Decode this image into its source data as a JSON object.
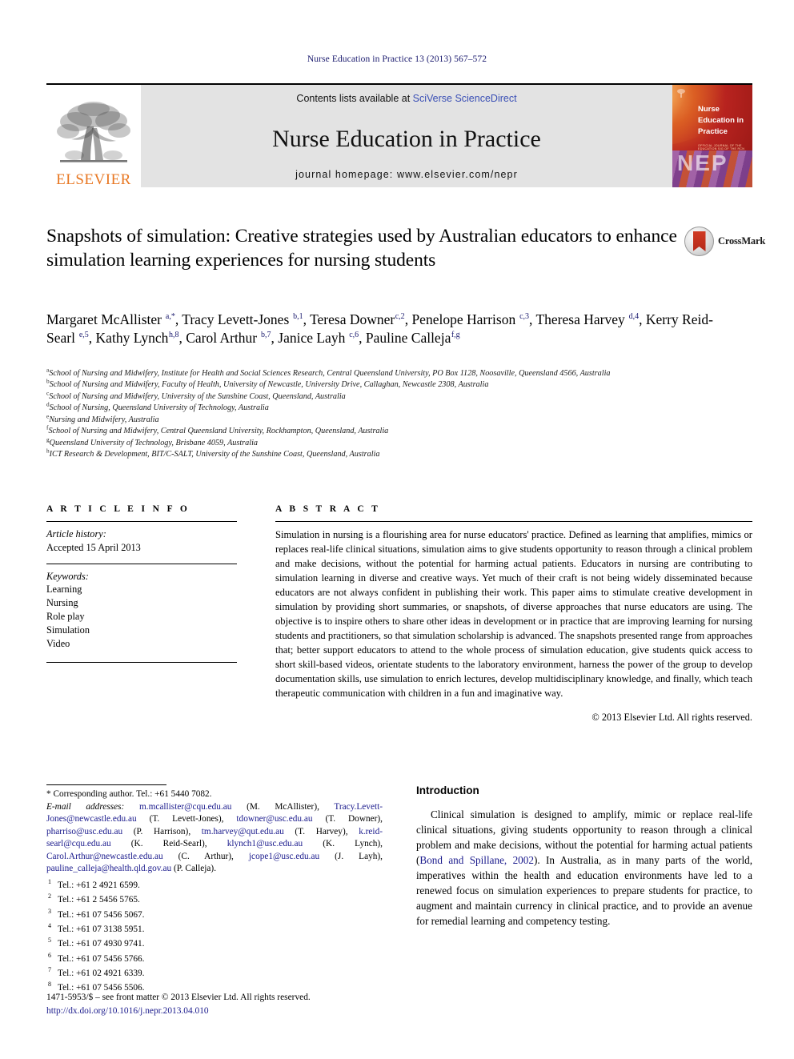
{
  "running_head": "Nurse Education in Practice 13 (2013) 567–572",
  "masthead": {
    "publisher_name": "ELSEVIER",
    "publisher_logo_icon": "elsevier-tree-icon",
    "contents_prefix": "Contents lists available at ",
    "contents_link": "SciVerse ScienceDirect",
    "journal_title": "Nurse Education in Practice",
    "homepage_line": "journal homepage: www.elsevier.com/nepr",
    "cover": {
      "title_lines": [
        "Nurse",
        "Education in",
        "Practice"
      ],
      "subtitle": "OFFICIAL JOURNAL OF THE EDUCATION SIG OF THE RCN",
      "acronym": "NEP"
    }
  },
  "article": {
    "title": "Snapshots of simulation: Creative strategies used by Australian educators to enhance simulation learning experiences for nursing students",
    "crossmark_label": "CrossMark",
    "crossmark_icon": "crossmark-badge-icon"
  },
  "authors_html": "Margaret McAllister <sup>a,*</sup>, Tracy Levett-Jones <sup>b,1</sup>, Teresa Downer<sup>c,2</sup>, Penelope Harrison <sup>c,3</sup>, Theresa Harvey <sup>d,4</sup>, Kerry Reid-Searl <sup>e,5</sup>, Kathy Lynch<sup>h,8</sup>, Carol Arthur <sup>b,7</sup>, Janice Layh <sup>c,6</sup>, Pauline Calleja<sup>f,g</sup>",
  "affiliations": [
    {
      "marker": "a",
      "text": "School of Nursing and Midwifery, Institute for Health and Social Sciences Research, Central Queensland University, PO Box 1128, Noosaville, Queensland 4566, Australia"
    },
    {
      "marker": "b",
      "text": "School of Nursing and Midwifery, Faculty of Health, University of Newcastle, University Drive, Callaghan, Newcastle 2308, Australia"
    },
    {
      "marker": "c",
      "text": "School of Nursing and Midwifery, University of the Sunshine Coast, Queensland, Australia"
    },
    {
      "marker": "d",
      "text": "School of Nursing, Queensland University of Technology, Australia"
    },
    {
      "marker": "e",
      "text": "Nursing and Midwifery, Australia"
    },
    {
      "marker": "f",
      "text": "School of Nursing and Midwifery, Central Queensland University, Rockhampton, Queensland, Australia"
    },
    {
      "marker": "g",
      "text": "Queensland University of Technology, Brisbane 4059, Australia"
    },
    {
      "marker": "h",
      "text": "ICT Research & Development, BIT/C-SALT, University of the Sunshine Coast, Queensland, Australia"
    }
  ],
  "article_info": {
    "heading": "A R T I C L E   I N F O",
    "history_label": "Article history:",
    "history_value": "Accepted 15 April 2013",
    "keywords_label": "Keywords:",
    "keywords": [
      "Learning",
      "Nursing",
      "Role play",
      "Simulation",
      "Video"
    ]
  },
  "abstract": {
    "heading": "A B S T R A C T",
    "body": "Simulation in nursing is a flourishing area for nurse educators' practice. Defined as learning that amplifies, mimics or replaces real-life clinical situations, simulation aims to give students opportunity to reason through a clinical problem and make decisions, without the potential for harming actual patients. Educators in nursing are contributing to simulation learning in diverse and creative ways. Yet much of their craft is not being widely disseminated because educators are not always confident in publishing their work. This paper aims to stimulate creative development in simulation by providing short summaries, or snapshots, of diverse approaches that nurse educators are using. The objective is to inspire others to share other ideas in development or in practice that are improving learning for nursing students and practitioners, so that simulation scholarship is advanced. The snapshots presented range from approaches that; better support educators to attend to the whole process of simulation education, give students quick access to short skill-based videos, orientate students to the laboratory environment, harness the power of the group to develop documentation skills, use simulation to enrich lectures, develop multidisciplinary knowledge, and finally, which teach therapeutic communication with children in a fun and imaginative way.",
    "copyright": "© 2013 Elsevier Ltd. All rights reserved."
  },
  "footnotes": {
    "corresponding": "* Corresponding author. Tel.: +61 5440 7082.",
    "email_label": "E-mail addresses:",
    "emails_html": "<span class=\"lnk\">m.mcallister@cqu.edu.au</span> (M. McAllister), <span class=\"lnk\">Tracy.Levett-Jones@newcastle.edu.au</span> (T. Levett-Jones), <span class=\"lnk\">tdowner@usc.edu.au</span> (T. Downer), <span class=\"lnk\">pharriso@usc.edu.au</span> (P. Harrison), <span class=\"lnk\">tm.harvey@qut.edu.au</span> (T. Harvey), <span class=\"lnk\">k.reid-searl@cqu.edu.au</span> (K. Reid-Searl), <span class=\"lnk\">klynch1@usc.edu.au</span> (K. Lynch), <span class=\"lnk\">Carol.Arthur@newcastle.edu.au</span> (C. Arthur), <span class=\"lnk\">jcope1@usc.edu.au</span> (J. Layh), <span class=\"lnk\">pauline_calleja@health.qld.gov.au</span> (P. Calleja).",
    "tels": [
      {
        "num": "1",
        "text": "Tel.: +61 2 4921 6599."
      },
      {
        "num": "2",
        "text": "Tel.: +61 2 5456 5765."
      },
      {
        "num": "3",
        "text": "Tel.: +61 07 5456 5067."
      },
      {
        "num": "4",
        "text": "Tel.: +61 07 3138 5951."
      },
      {
        "num": "5",
        "text": "Tel.: +61 07 4930 9741."
      },
      {
        "num": "6",
        "text": "Tel.: +61 07 5456 5766."
      },
      {
        "num": "7",
        "text": "Tel.: +61 02 4921 6339."
      },
      {
        "num": "8",
        "text": "Tel.: +61 07 5456 5506."
      }
    ]
  },
  "introduction": {
    "heading": "Introduction",
    "paragraph_html": "Clinical simulation is designed to amplify, mimic or replace real-life clinical situations, giving students opportunity to reason through a clinical problem and make decisions, without the potential for harming actual patients (<span class=\"cite\">Bond and Spillane, 2002</span>). In Australia, as in many parts of the world, imperatives within the health and education environments have led to a renewed focus on simulation experiences to prepare students for practice, to augment and maintain currency in clinical practice, and to provide an avenue for remedial learning and competency testing."
  },
  "page_footer": {
    "issn_line": "1471-5953/$ – see front matter © 2013 Elsevier Ltd. All rights reserved.",
    "doi": "http://dx.doi.org/10.1016/j.nepr.2013.04.010"
  },
  "colors": {
    "link": "#1a1a8c",
    "running_head": "#1a1a6e",
    "elsevier_orange": "#E87722",
    "masthead_bg": "#e3e3e3"
  }
}
